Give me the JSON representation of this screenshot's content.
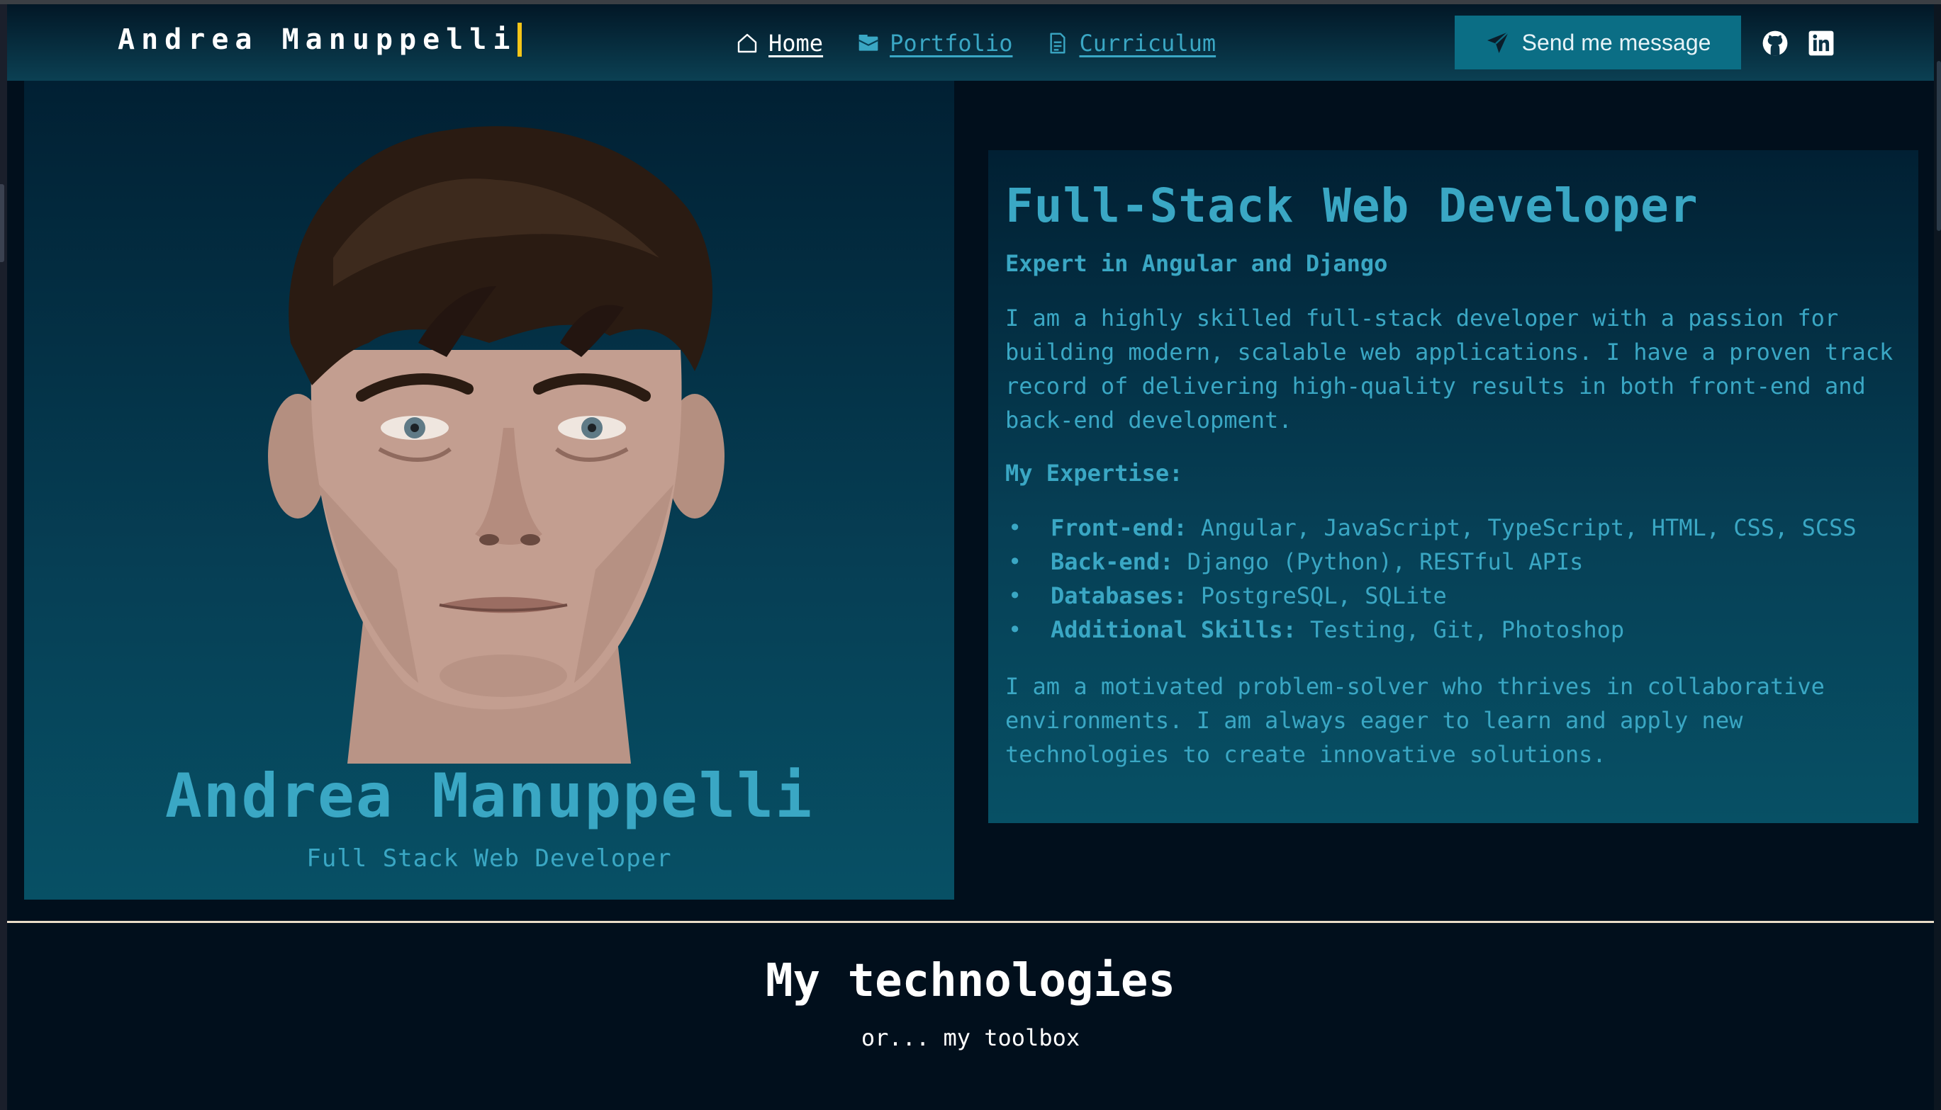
{
  "navbar": {
    "brand": "Andrea Manuppelli",
    "links": [
      {
        "label": "Home",
        "icon": "home-icon"
      },
      {
        "label": "Portfolio",
        "icon": "folder-icon"
      },
      {
        "label": "Curriculum",
        "icon": "document-icon"
      }
    ],
    "send_label": "Send me message",
    "send_icon": "paper-plane-icon",
    "social": [
      "github-icon",
      "linkedin-icon"
    ]
  },
  "profile": {
    "name": "Andrea Manuppelli",
    "role": "Full Stack Web Developer"
  },
  "info": {
    "title": "Full-Stack Web Developer",
    "subtitle": "Expert in Angular and Django",
    "intro": "I am a highly skilled full-stack developer with a passion for building modern, scalable web applications. I have a proven track record of delivering high-quality results in both front-end and back-end development.",
    "expertise_heading": "My Expertise:",
    "expertise": [
      {
        "label": "Front-end:",
        "value": " Angular, JavaScript, TypeScript, HTML, CSS, SCSS"
      },
      {
        "label": "Back-end:",
        "value": " Django (Python), RESTful APIs"
      },
      {
        "label": "Databases:",
        "value": " PostgreSQL, SQLite"
      },
      {
        "label": "Additional Skills:",
        "value": " Testing, Git, Photoshop"
      }
    ],
    "outro": "I am a motivated problem-solver who thrives in collaborative environments. I am always eager to learn and apply new technologies to create innovative solutions."
  },
  "technologies": {
    "title": "My technologies",
    "subtitle": "or... my toolbox"
  },
  "colors": {
    "accent": "#3aa7c4",
    "button": "#0b6e85",
    "background": "#010f1c",
    "caret": "#f5c518"
  }
}
